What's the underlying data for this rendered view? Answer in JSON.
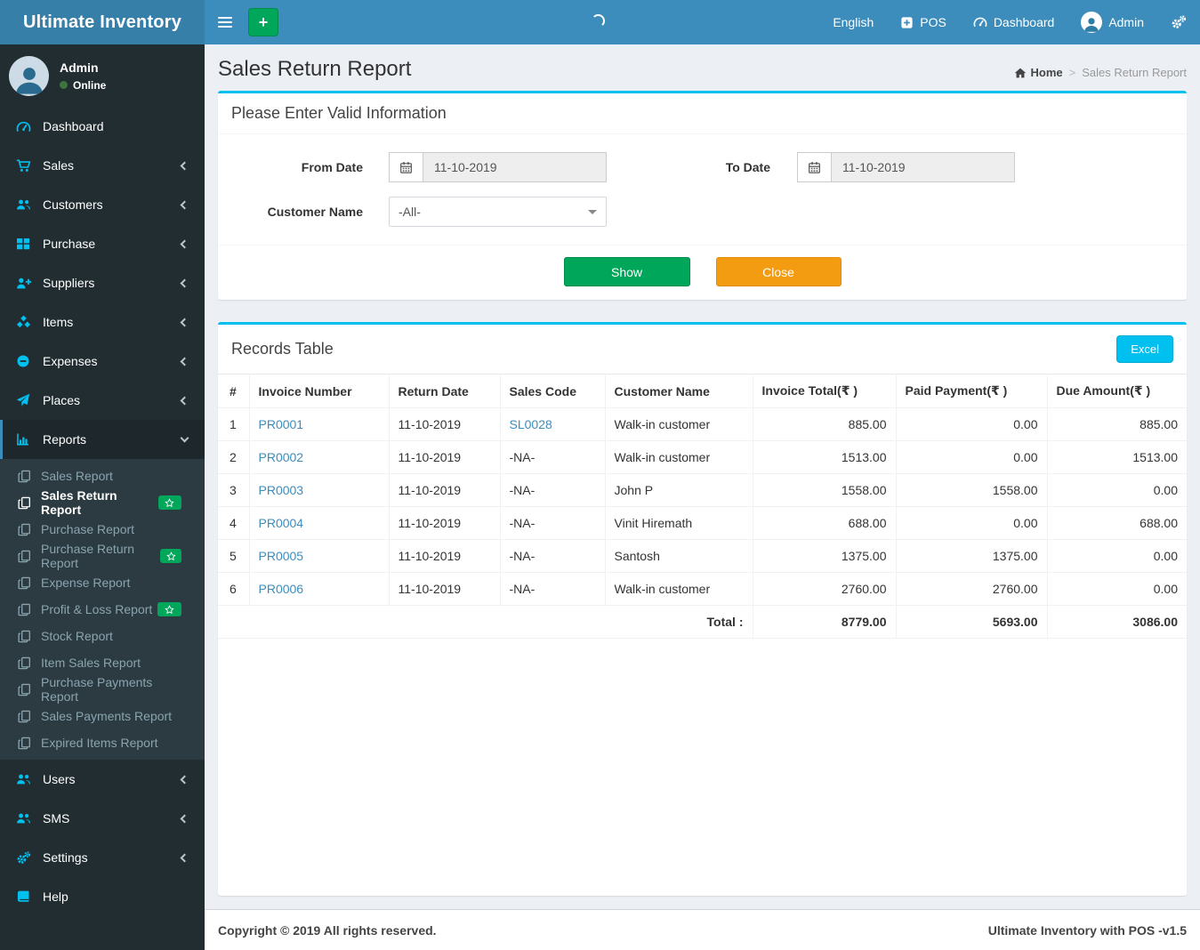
{
  "navbar": {
    "brand": "Ultimate Inventory",
    "language": "English",
    "pos": "POS",
    "dashboard": "Dashboard",
    "user": "Admin"
  },
  "user_panel": {
    "name": "Admin",
    "status": "Online"
  },
  "sidebar": {
    "items": [
      {
        "label": "Dashboard"
      },
      {
        "label": "Sales"
      },
      {
        "label": "Customers"
      },
      {
        "label": "Purchase"
      },
      {
        "label": "Suppliers"
      },
      {
        "label": "Items"
      },
      {
        "label": "Expenses"
      },
      {
        "label": "Places"
      },
      {
        "label": "Reports"
      }
    ],
    "reports_submenu": [
      {
        "label": "Sales Report"
      },
      {
        "label": "Sales Return Report",
        "active": true,
        "badge": "star"
      },
      {
        "label": "Purchase Report"
      },
      {
        "label": "Purchase Return Report",
        "badge": "star"
      },
      {
        "label": "Expense Report"
      },
      {
        "label": "Profit & Loss Report",
        "badge": "star"
      },
      {
        "label": "Stock Report"
      },
      {
        "label": "Item Sales Report"
      },
      {
        "label": "Purchase Payments Report"
      },
      {
        "label": "Sales Payments Report"
      },
      {
        "label": "Expired Items Report"
      }
    ],
    "items_bottom": [
      {
        "label": "Users"
      },
      {
        "label": "SMS"
      },
      {
        "label": "Settings"
      },
      {
        "label": "Help"
      }
    ]
  },
  "page": {
    "title": "Sales Return Report",
    "breadcrumb": {
      "home": "Home",
      "current": "Sales Return Report"
    }
  },
  "filter": {
    "title": "Please Enter Valid Information",
    "from_date": {
      "label": "From Date",
      "value": "11-10-2019"
    },
    "to_date": {
      "label": "To Date",
      "value": "11-10-2019"
    },
    "customer": {
      "label": "Customer Name",
      "value": "-All-"
    },
    "show": "Show",
    "close": "Close"
  },
  "records": {
    "title": "Records Table",
    "excel": "Excel",
    "columns": [
      "#",
      "Invoice Number",
      "Return Date",
      "Sales Code",
      "Customer Name",
      "Invoice Total(₹ )",
      "Paid Payment(₹ )",
      "Due Amount(₹ )"
    ],
    "rows": [
      {
        "num": "1",
        "invoice": "PR0001",
        "date": "11-10-2019",
        "code": "SL0028",
        "customer": "Walk-in customer",
        "invoice_total": "885.00",
        "paid": "0.00",
        "due": "885.00"
      },
      {
        "num": "2",
        "invoice": "PR0002",
        "date": "11-10-2019",
        "code": "-NA-",
        "customer": "Walk-in customer",
        "invoice_total": "1513.00",
        "paid": "0.00",
        "due": "1513.00"
      },
      {
        "num": "3",
        "invoice": "PR0003",
        "date": "11-10-2019",
        "code": "-NA-",
        "customer": "John P",
        "invoice_total": "1558.00",
        "paid": "1558.00",
        "due": "0.00"
      },
      {
        "num": "4",
        "invoice": "PR0004",
        "date": "11-10-2019",
        "code": "-NA-",
        "customer": "Vinit Hiremath",
        "invoice_total": "688.00",
        "paid": "0.00",
        "due": "688.00"
      },
      {
        "num": "5",
        "invoice": "PR0005",
        "date": "11-10-2019",
        "code": "-NA-",
        "customer": "Santosh",
        "invoice_total": "1375.00",
        "paid": "1375.00",
        "due": "0.00"
      },
      {
        "num": "6",
        "invoice": "PR0006",
        "date": "11-10-2019",
        "code": "-NA-",
        "customer": "Walk-in customer",
        "invoice_total": "2760.00",
        "paid": "2760.00",
        "due": "0.00"
      }
    ],
    "total_label": "Total :",
    "totals": {
      "invoice_total": "8779.00",
      "paid": "5693.00",
      "due": "3086.00"
    }
  },
  "footer": {
    "left": "Copyright © 2019 All rights reserved.",
    "right": "Ultimate Inventory with POS -v1.5"
  },
  "colors": {
    "navbar": "#3c8dbc",
    "logo": "#367fa9",
    "sidebar": "#222d32",
    "submenu": "#2c3b41",
    "accent": "#00c0ef",
    "green": "#00a65a",
    "orange": "#f39c12",
    "content_bg": "#ecf0f5"
  }
}
